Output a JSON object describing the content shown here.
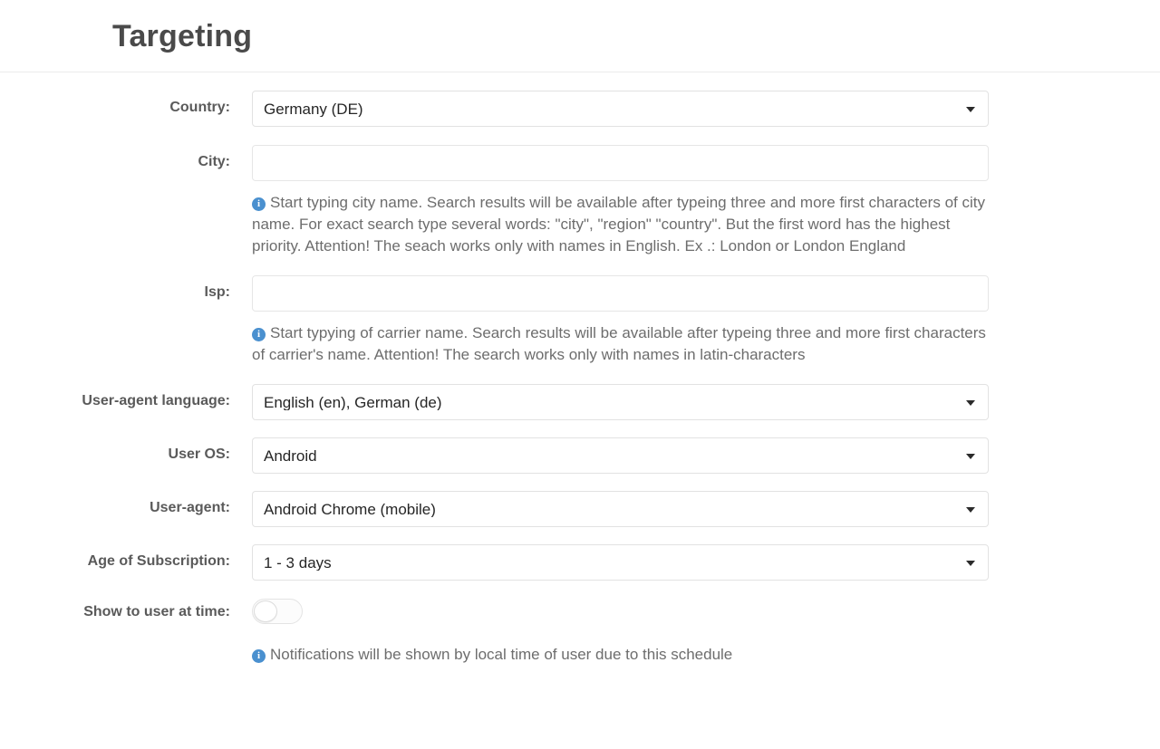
{
  "header": {
    "title": "Targeting"
  },
  "form": {
    "country": {
      "label": "Country:",
      "value": "Germany (DE)",
      "caret_icon": "chevron-down-icon"
    },
    "city": {
      "label": "City:",
      "value": "",
      "placeholder": "",
      "help_icon": "info-icon",
      "help": "Start typing city name. Search results will be available after typeing three and more first characters of city name. For exact search type several words: \"city\", \"region\" \"country\". But the first word has the highest priority. Attention! The seach works only with names in English. Ex .: London or London England"
    },
    "isp": {
      "label": "Isp:",
      "value": "",
      "placeholder": "",
      "help_icon": "info-icon",
      "help": "Start typying of carrier name. Search results will be available after typeing three and more first characters of carrier's name. Attention! The search works only with names in latin-characters"
    },
    "user_agent_language": {
      "label": "User-agent language:",
      "value": "English (en), German (de)",
      "caret_icon": "chevron-down-icon"
    },
    "user_os": {
      "label": "User OS:",
      "value": "Android",
      "caret_icon": "chevron-down-icon"
    },
    "user_agent": {
      "label": "User-agent:",
      "value": "Android Chrome (mobile)",
      "caret_icon": "chevron-down-icon"
    },
    "age_of_subscription": {
      "label": "Age of Subscription:",
      "value": "1 - 3 days",
      "caret_icon": "chevron-down-icon"
    },
    "show_to_user_at_time": {
      "label": "Show to user at time:",
      "state": "off",
      "help_icon": "info-icon",
      "help": "Notifications will be shown by local time of user due to this schedule"
    }
  },
  "colors": {
    "info_blue": "#4a90cf",
    "label_gray": "#5a5a5a",
    "help_gray": "#6d6d6d",
    "border": "#e2e2e2",
    "title": "#4a4a4a"
  }
}
